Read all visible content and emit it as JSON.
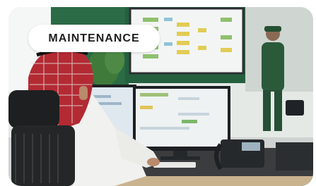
{
  "badge": {
    "label": "MAINTENANCE"
  },
  "colors": {
    "wall": "#e4e9e6",
    "green_wall": "#2b6b45",
    "desk": "#3a3c3e",
    "monitor_frame": "#1d2023",
    "ghutra_red": "#b32a33",
    "thobe_white": "#f1f1ef",
    "worker_uniform": "#2a5a3a"
  },
  "icons": [
    "control-room-photo"
  ]
}
